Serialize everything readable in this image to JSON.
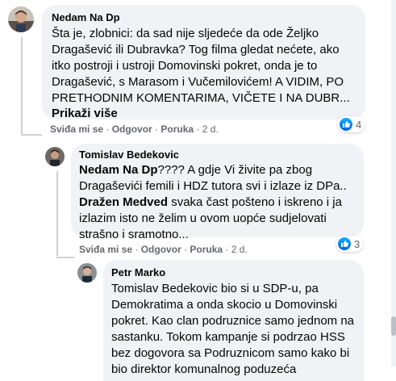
{
  "comment1": {
    "author": "Nedam Na Dp",
    "text": "Šta je, zlobnici: da sad nije sljedeće da ode Željko Dragašević ili Dubravka? Tog filma gledat nećete, ako itko postroji i ustroji Domovinski pokret, onda je to Dragašević, s Marasom i Vučemilovićem! A VIDIM, PO PRETHODNIM KOMENTARIMA, VIČETE I NA DUBR...",
    "see_more": "Prikaži više",
    "like": "Sviđa mi se",
    "reply": "Odgovor",
    "message": "Poruka",
    "time": "2 d.",
    "reaction_count": "4"
  },
  "comment2": {
    "author": "Tomislav Bedekovic",
    "mention1": "Nedam Na Dp",
    "text1": "???? A gdje Vi živite pa zbog Dragaševići femili i HDZ tutora svi i izlaze iz DPa..",
    "mention2": "Dražen Medved",
    "text2": " svaka čast pošteno i iskreno i ja izlazim isto ne želim u ovom uopće sudjelovati strašno i sramotno...",
    "like": "Sviđa mi se",
    "reply": "Odgovor",
    "message": "Poruka",
    "time": "2 d.",
    "reaction_count": "3"
  },
  "comment3": {
    "author": "Petr Marko",
    "text": "Tomislav Bedekovic bio si u SDP-u, pa Demokratima a onda skocio u Domovinski pokret. Kao clan podruznice samo jednom na sastanku. Tokom kampanje si podrzao HSS bez dogovora sa Podruznicom samo kako bi bio direktor komunalnog poduzeća"
  },
  "colors": {
    "bubble": "#f0f2f5",
    "meta": "#65676b",
    "like_blue": "#0866ff"
  },
  "icons": [
    "like-icon"
  ]
}
